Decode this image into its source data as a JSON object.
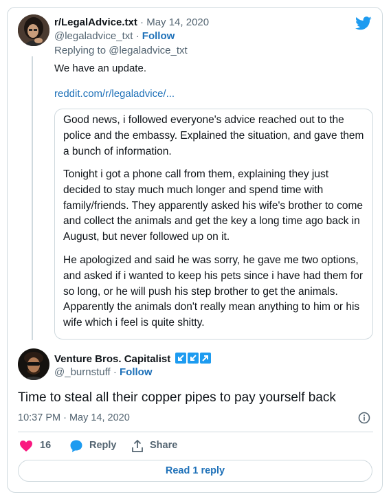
{
  "colors": {
    "border": "#cfd9de",
    "link": "#1d70b8",
    "muted": "#536471",
    "twitter_blue": "#1d9bf0",
    "heart_red": "#f91880"
  },
  "reply_to_tweet": {
    "display_name": "r/LegalAdvice.txt",
    "date": "· May 14, 2020",
    "handle": "@legaladvice_txt ·",
    "follow_label": "Follow",
    "replying_to": "Replying to @legaladvice_txt",
    "text": "We have an update.",
    "link": "reddit.com/r/legaladvice/...",
    "quoted_paragraphs": [
      "Good news, i followed everyone's advice reached out to the police and the embassy. Explained the situation, and gave them a bunch of information.",
      "Tonight i got a phone call from them, explaining they just decided to stay much much longer and spend time with family/friends. They apparently asked his wife's brother to come and collect the animals and get the key a long time ago back in August, but never followed up on it.",
      "He apologized and said he was sorry, he gave me two options, and asked if i wanted to keep his pets since i have had them for so long, or he will push his step brother to get the animals. Apparently the animals don't really mean anything to him or his wife which i feel is quite shitty."
    ]
  },
  "main_tweet": {
    "display_name": "Venture Bros. Capitalist",
    "handle": "@_burnstuff ·",
    "follow_label": "Follow",
    "badges": [
      "arrow-down-left-icon",
      "arrow-down-left-icon",
      "arrow-up-right-icon"
    ],
    "text": "Time to steal all their copper pipes to pay yourself back",
    "timestamp": "10:37 PM · May 14, 2020"
  },
  "actions": {
    "like_count": "16",
    "reply_label": "Reply",
    "share_label": "Share",
    "read_replies_label": "Read 1 reply"
  }
}
